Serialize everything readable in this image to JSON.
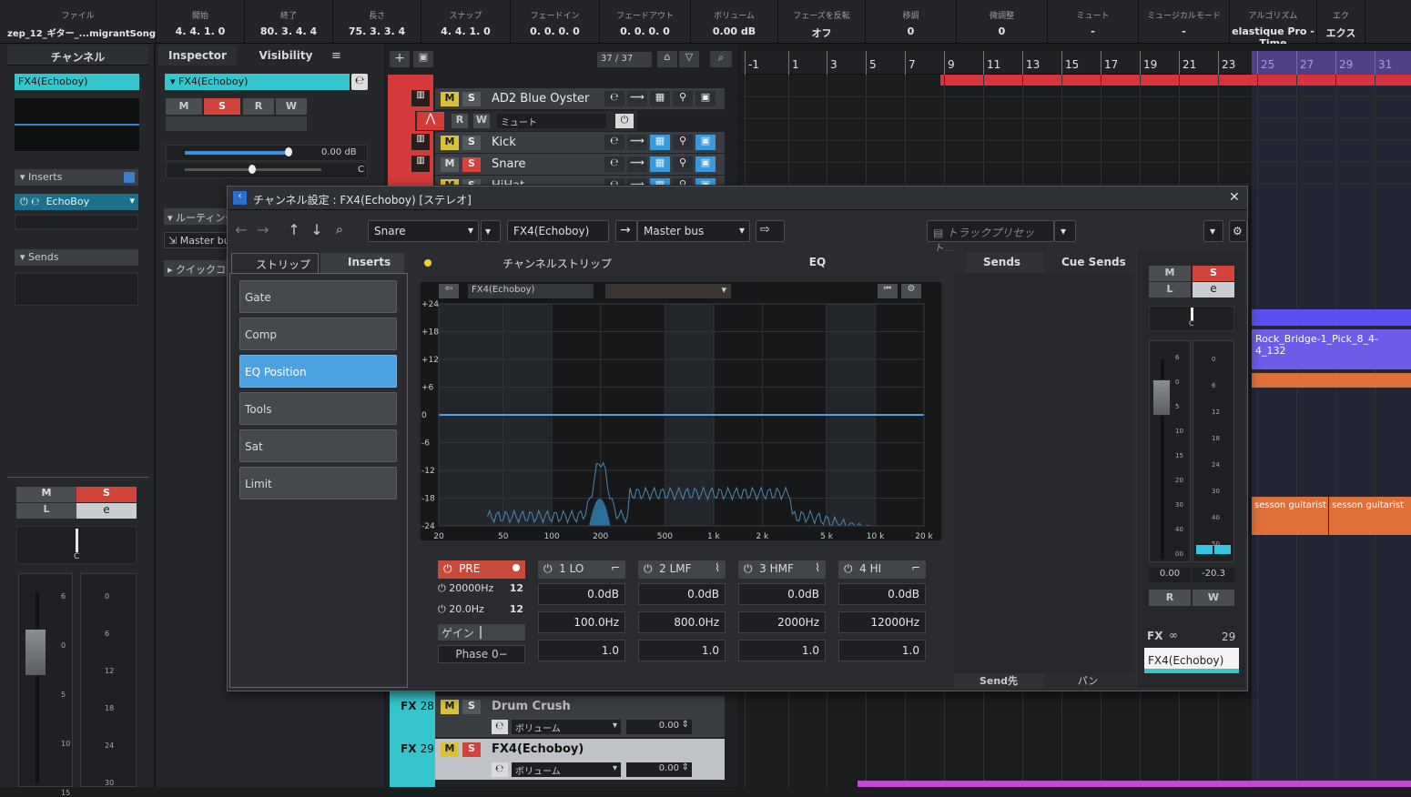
{
  "infoline": [
    {
      "label": "ファイル",
      "value": "zep_12_ギター_...migrantSong"
    },
    {
      "label": "開始",
      "value": "4. 4. 1.   0"
    },
    {
      "label": "終了",
      "value": "80. 3. 4.   4"
    },
    {
      "label": "長さ",
      "value": "75. 3. 3.   4"
    },
    {
      "label": "スナップ",
      "value": "4. 4. 1.   0"
    },
    {
      "label": "フェードイン",
      "value": "0. 0. 0.   0"
    },
    {
      "label": "フェードアウト",
      "value": "0. 0. 0.   0"
    },
    {
      "label": "ボリューム",
      "value": "0.00          dB"
    },
    {
      "label": "フェーズを反転",
      "value": "オフ"
    },
    {
      "label": "移調",
      "value": "0"
    },
    {
      "label": "微調整",
      "value": "0"
    },
    {
      "label": "ミュート",
      "value": "-"
    },
    {
      "label": "ミュージカルモード",
      "value": "-"
    },
    {
      "label": "アルゴリズム",
      "value": "elastique Pro - Time"
    },
    {
      "label": "エク",
      "value": "エクス"
    }
  ],
  "channel_panel": {
    "tab": "チャンネル",
    "channel_name": "FX4(Echoboy)",
    "inserts_label": "Inserts",
    "insert_plugin": "EchoBoy",
    "sends_label": "Sends",
    "m": "M",
    "s": "S",
    "l": "L",
    "e": "e",
    "pan": "C",
    "fader_scale": [
      "6",
      "0",
      "5",
      "10",
      "15"
    ],
    "meter_scale": [
      "0",
      "6",
      "12",
      "18",
      "24",
      "30"
    ]
  },
  "inspector": {
    "tab_inspector": "Inspector",
    "tab_visibility": "Visibility",
    "menu": "≡",
    "channel_name": "FX4(Echoboy)",
    "m": "M",
    "s": "S",
    "r": "R",
    "w": "W",
    "volume": "0.00 dB",
    "pan": "C",
    "routing": "ルーティング",
    "master_bus": "Master bus",
    "quick": "クイックコントロール"
  },
  "tracklist": {
    "counter": "37 / 37",
    "tracks": [
      {
        "name": "AD2 Blue Oyster"
      },
      {
        "name": "Kick"
      },
      {
        "name": "Snare"
      },
      {
        "name": "HiHat"
      }
    ],
    "bottom_tracks": [
      {
        "fx": "FX",
        "num": "28",
        "name": "Drum Crush",
        "param": "ボリューム",
        "value": "0.00"
      },
      {
        "fx": "FX",
        "num": "29",
        "name": "FX4(Echoboy)",
        "param": "ボリューム",
        "value": "0.00"
      }
    ],
    "r": "R",
    "w": "W",
    "mute": "ミュート",
    "m": "M",
    "s": "S"
  },
  "ruler": [
    "-1",
    "1",
    "3",
    "5",
    "7",
    "9",
    "11",
    "13",
    "15",
    "17",
    "19",
    "21",
    "23",
    "25",
    "27",
    "29",
    "31"
  ],
  "events": [
    {
      "label": "Rock_Bridge-1_Pick_8_4-4_132"
    },
    {
      "label": "sesson guitarist"
    },
    {
      "label": "sesson guitarist"
    }
  ],
  "dialog": {
    "title": "チャンネル設定 : FX4(Echoboy) [ステレオ]",
    "close": "✕",
    "input_sel": "Snare",
    "channel_field": "FX4(Echoboy)",
    "output_sel": "Master bus",
    "track_preset": "トラックプリセット...",
    "tabs": {
      "strip": "ストリップ",
      "inserts": "Inserts",
      "channel_strip": "チャンネルストリップ",
      "eq": "EQ",
      "sends": "Sends",
      "cue_sends": "Cue Sends"
    },
    "strip_items": [
      "Gate",
      "Comp",
      "EQ Position",
      "Tools",
      "Sat",
      "Limit"
    ],
    "eq_display_name": "FX4(Echoboy)",
    "db_ticks": [
      "+24",
      "+18",
      "+12",
      "+6",
      "0",
      "-6",
      "-12",
      "-18",
      "-24"
    ],
    "freq_ticks": [
      "20",
      "50",
      "100",
      "200",
      "500",
      "1 k",
      "2 k",
      "5 k",
      "10 k",
      "20 k"
    ],
    "pre": {
      "label": "PRE",
      "hp_freq": "20000Hz",
      "hp_slope": "12",
      "lp_freq": "20.0Hz",
      "lp_slope": "12",
      "gain": "ゲイン",
      "phase": "Phase 0−"
    },
    "bands": [
      {
        "label": "1 LO",
        "gain": "0.0dB",
        "freq": "100.0Hz",
        "q": "1.0"
      },
      {
        "label": "2 LMF",
        "gain": "0.0dB",
        "freq": "800.0Hz",
        "q": "1.0"
      },
      {
        "label": "3 HMF",
        "gain": "0.0dB",
        "freq": "2000Hz",
        "q": "1.0"
      },
      {
        "label": "4 HI",
        "gain": "0.0dB",
        "freq": "12000Hz",
        "q": "1.0"
      }
    ],
    "send_footer": {
      "dest": "Send先",
      "pan": "パン"
    },
    "mixer": {
      "m": "M",
      "s": "S",
      "l": "L",
      "e": "e",
      "pan": "C",
      "fader_val": "0.00",
      "meter_val": "-20.3",
      "r": "R",
      "w": "W",
      "fx": "FX",
      "fx_num": "29",
      "name": "FX4(Echoboy)",
      "fader_scale": [
        "6",
        "0",
        "5",
        "10",
        "15",
        "20",
        "30",
        "40",
        "00"
      ],
      "meter_scale": [
        "0",
        "6",
        "12",
        "18",
        "24",
        "30",
        "40",
        "50"
      ]
    }
  }
}
